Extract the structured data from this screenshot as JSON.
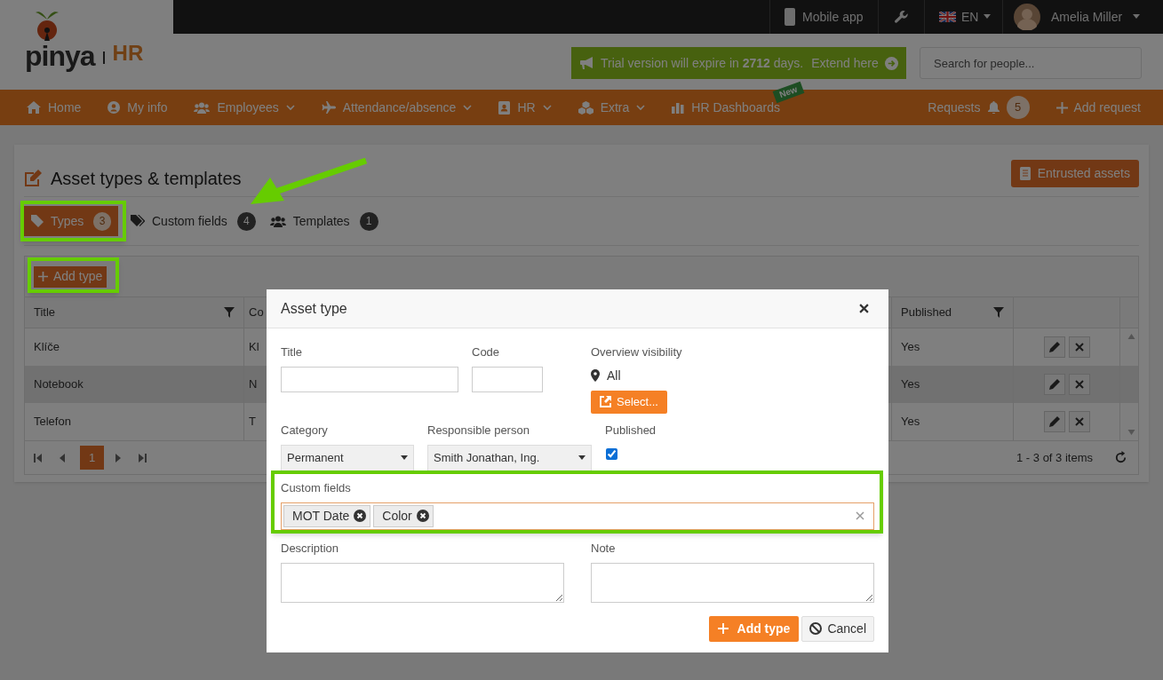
{
  "top_bar": {
    "mobile_app": "Mobile app",
    "language": "EN",
    "user": "Amelia Miller"
  },
  "logo": {
    "name": "pinya",
    "product": "HR"
  },
  "trial_banner": {
    "text": "Trial version will expire in **2712** days.",
    "link": "Extend here"
  },
  "search": {
    "placeholder": "Search for people..."
  },
  "nav": {
    "items": [
      {
        "label": "Home",
        "dropdown": false
      },
      {
        "label": "My info",
        "dropdown": false
      },
      {
        "label": "Employees",
        "dropdown": true
      },
      {
        "label": "Attendance/absence",
        "dropdown": true
      },
      {
        "label": "HR",
        "dropdown": true
      },
      {
        "label": "Extra",
        "dropdown": true
      },
      {
        "label": "HR Dashboards",
        "dropdown": false,
        "badge": "New"
      }
    ],
    "requests": {
      "label": "Requests",
      "count": "5"
    },
    "add_request": "Add request"
  },
  "page": {
    "title": "Asset types & templates",
    "action": "Entrusted assets"
  },
  "tabs": [
    {
      "label": "Types",
      "count": "3",
      "selected": true
    },
    {
      "label": "Custom fields",
      "count": "4",
      "selected": false
    },
    {
      "label": "Templates",
      "count": "1",
      "selected": false
    }
  ],
  "grid": {
    "add_button": "Add type",
    "columns": [
      {
        "label": "Title",
        "filter": true
      },
      {
        "label": "Co"
      },
      {
        "label": "Published",
        "filter": true
      }
    ],
    "rows": [
      {
        "cells": [
          "Klíče",
          "Kl",
          "Yes"
        ],
        "highlighted": false
      },
      {
        "cells": [
          "Notebook",
          "N",
          "Yes"
        ],
        "highlighted": true
      },
      {
        "cells": [
          "Telefon",
          "T",
          "Yes"
        ],
        "highlighted": false
      }
    ],
    "pages": [
      {
        "label": "1",
        "selected": true
      }
    ],
    "summary": "1 - 3 of 3 items"
  },
  "modal": {
    "title": "Asset type",
    "title_label": "Title",
    "code_label": "Code",
    "visibility": {
      "label": "Overview visibility",
      "value": "All",
      "button": "Select..."
    },
    "category": {
      "label": "Category",
      "value": "Permanent"
    },
    "responsible": {
      "label": "Responsible person",
      "value": "Smith Jonathan, Ing."
    },
    "published": {
      "label": "Published",
      "checked": true
    },
    "custom_fields": {
      "label": "Custom fields",
      "tags": [
        "MOT Date",
        "Color"
      ]
    },
    "description_label": "Description",
    "note_label": "Note",
    "submit": "Add type",
    "cancel": "Cancel"
  }
}
